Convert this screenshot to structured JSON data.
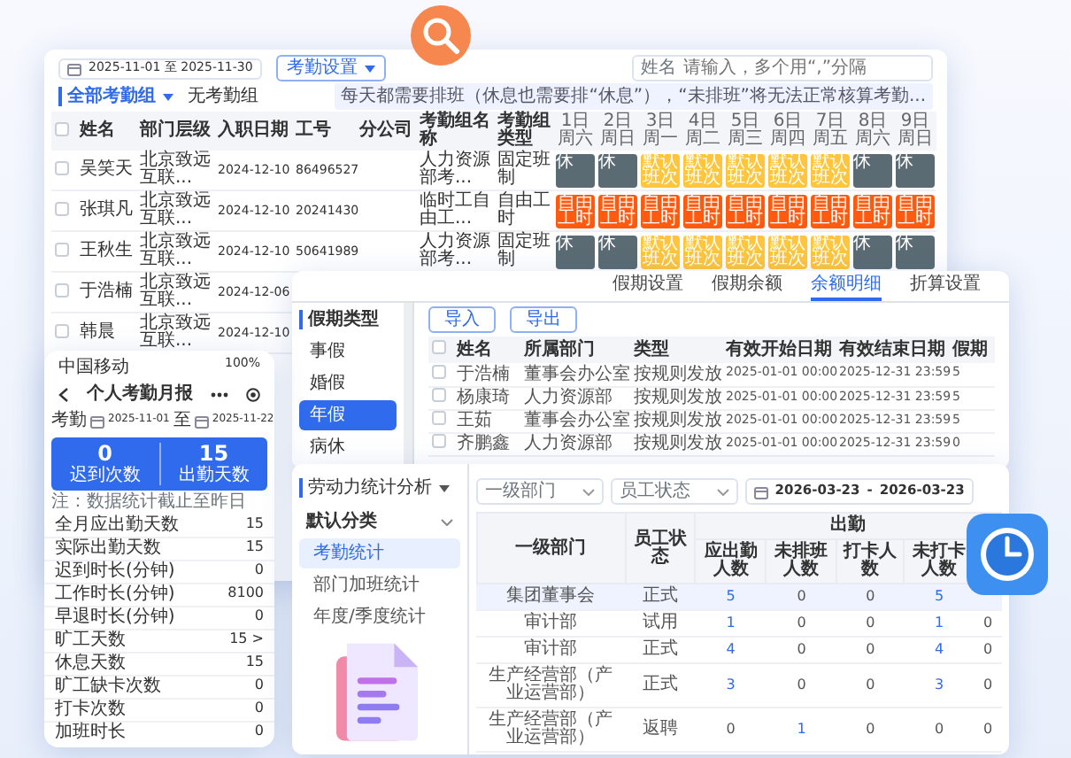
{
  "attendance_window": {
    "date_range": "2025-11-01 至 2025-11-30",
    "settings_button": "考勤设置",
    "search": {
      "label": "姓名",
      "placeholder": "请输入，多个用“,”分隔"
    },
    "group_filter": "全部考勤组",
    "no_group": "无考勤组",
    "notice": "每天都需要排班（休息也需要排“休息”），“未排班”将无法正常核算考勤...",
    "columns": [
      "姓名",
      "部门层级",
      "入职日期",
      "工号",
      "分公司",
      "考勤组名称",
      "考勤组类型"
    ],
    "days": [
      {
        "day": "1日",
        "weekday": "周六"
      },
      {
        "day": "2日",
        "weekday": "周日"
      },
      {
        "day": "3日",
        "weekday": "周一"
      },
      {
        "day": "4日",
        "weekday": "周二"
      },
      {
        "day": "5日",
        "weekday": "周三"
      },
      {
        "day": "6日",
        "weekday": "周四"
      },
      {
        "day": "7日",
        "weekday": "周五"
      },
      {
        "day": "8日",
        "weekday": "周六"
      },
      {
        "day": "9日",
        "weekday": "周日"
      }
    ],
    "select_all_checked": false,
    "rows": [
      {
        "checked": false,
        "name": "吴笑天",
        "dept": "北京致远互联...",
        "hire_date": "2024-12-10",
        "employee_no": "86496527",
        "group": "人力资源部考...",
        "group_type": "固定班制",
        "shifts": [
          {
            "kind": "rest",
            "label": "休"
          },
          {
            "kind": "rest",
            "label": "休"
          },
          {
            "kind": "default",
            "label": "默认班次"
          },
          {
            "kind": "default",
            "label": "默认班次"
          },
          {
            "kind": "default",
            "label": "默认班次"
          },
          {
            "kind": "default",
            "label": "默认班次"
          },
          {
            "kind": "default",
            "label": "默认班次"
          },
          {
            "kind": "rest",
            "label": "休"
          },
          {
            "kind": "rest",
            "label": "休"
          }
        ]
      },
      {
        "checked": false,
        "name": "张琪凡",
        "dept": "北京致远互联...",
        "hire_date": "2024-12-10",
        "employee_no": "20241430",
        "group": "临时工自由工...",
        "group_type": "自由工时",
        "shifts": [
          {
            "kind": "free",
            "label": "自由工时"
          },
          {
            "kind": "free",
            "label": "自由工时"
          },
          {
            "kind": "free",
            "label": "自由工时"
          },
          {
            "kind": "free",
            "label": "自由工时"
          },
          {
            "kind": "free",
            "label": "自由工时"
          },
          {
            "kind": "free",
            "label": "自由工时"
          },
          {
            "kind": "free",
            "label": "自由工时"
          },
          {
            "kind": "free",
            "label": "自由工时"
          },
          {
            "kind": "free",
            "label": "自由工时"
          }
        ]
      },
      {
        "checked": false,
        "name": "王秋生",
        "dept": "北京致远互联...",
        "hire_date": "2024-12-10",
        "employee_no": "50641989",
        "group": "人力资源部考...",
        "group_type": "固定班制",
        "shifts": [
          {
            "kind": "rest",
            "label": "休"
          },
          {
            "kind": "rest",
            "label": "休"
          },
          {
            "kind": "default",
            "label": "默认班次"
          },
          {
            "kind": "default",
            "label": "默认班次"
          },
          {
            "kind": "default",
            "label": "默认班次"
          },
          {
            "kind": "default",
            "label": "默认班次"
          },
          {
            "kind": "default",
            "label": "默认班次"
          },
          {
            "kind": "rest",
            "label": "休"
          },
          {
            "kind": "rest",
            "label": "休"
          }
        ]
      },
      {
        "checked": false,
        "name": "于浩楠",
        "dept": "北京致远互联...",
        "hire_date": "2024-12-06"
      },
      {
        "checked": false,
        "name": "韩晨",
        "dept": "北京致远互联...",
        "hire_date": "2024-12-10"
      }
    ]
  },
  "leave_window": {
    "tabs": [
      {
        "label": "假期设置",
        "selected": false
      },
      {
        "label": "假期余额",
        "selected": false
      },
      {
        "label": "余额明细",
        "selected": true
      },
      {
        "label": "折算设置",
        "selected": false
      }
    ],
    "sidebar_title": "假期类型",
    "leave_types": [
      {
        "label": "事假",
        "selected": false
      },
      {
        "label": "婚假",
        "selected": false
      },
      {
        "label": "年假",
        "selected": true
      },
      {
        "label": "病休",
        "selected": false
      }
    ],
    "buttons": [
      "导入",
      "导出"
    ],
    "select_all_checked": false,
    "columns": [
      "姓名",
      "所属部门",
      "类型",
      "有效开始日期",
      "有效结束日期",
      "假期"
    ],
    "rows": [
      {
        "checked": false,
        "cells": [
          "于浩楠",
          "董事会办公室",
          "按规则发放",
          "2025-01-01 00:00",
          "2025-12-31 23:59",
          "5"
        ]
      },
      {
        "checked": false,
        "cells": [
          "杨康琦",
          "人力资源部",
          "按规则发放",
          "2025-01-01 00:00",
          "2025-12-31 23:59",
          "5"
        ]
      },
      {
        "checked": false,
        "cells": [
          "王茹",
          "董事会办公室",
          "按规则发放",
          "2025-01-01 00:00",
          "2025-12-31 23:59",
          "5"
        ]
      },
      {
        "checked": false,
        "cells": [
          "齐鹏鑫",
          "人力资源部",
          "按规则发放",
          "2025-01-01 00:00",
          "2025-12-31 23:59",
          "0"
        ]
      }
    ]
  },
  "mobile": {
    "carrier": "中国移动",
    "battery": "100%",
    "title": "个人考勤月报",
    "date_label": "考勤",
    "date_from": "2025-11-01",
    "date_sep": "至",
    "date_to": "2025-11-22",
    "summary": [
      {
        "value": "0",
        "label": "迟到次数"
      },
      {
        "value": "15",
        "label": "出勤天数"
      }
    ],
    "note": "注：数据统计截止至昨日",
    "stats": [
      {
        "label": "全月应出勤天数",
        "value": "15"
      },
      {
        "label": "实际出勤天数",
        "value": "15"
      },
      {
        "label": "迟到时长(分钟)",
        "value": "0"
      },
      {
        "label": "工作时长(分钟)",
        "value": "8100"
      },
      {
        "label": "早退时长(分钟)",
        "value": "0"
      },
      {
        "label": "旷工天数",
        "value": "15 >"
      },
      {
        "label": "休息天数",
        "value": "15"
      },
      {
        "label": "旷工缺卡次数",
        "value": "0"
      },
      {
        "label": "打卡次数",
        "value": "0"
      },
      {
        "label": "加班时长",
        "value": "0"
      }
    ]
  },
  "stats_window": {
    "module": "劳动力统计分析",
    "category": "默认分类",
    "menu": [
      {
        "label": "考勤统计",
        "selected": true
      },
      {
        "label": "部门加班统计",
        "selected": false
      },
      {
        "label": "年度/季度统计",
        "selected": false
      }
    ],
    "filters": [
      {
        "placeholder": "一级部门"
      },
      {
        "placeholder": "员工状态"
      }
    ],
    "date_from": "2026-03-23",
    "date_sep": "-",
    "date_to": "2026-03-23",
    "columns": [
      "一级部门",
      "员工状态"
    ],
    "group_header": "出勤",
    "sub_columns": [
      "应出勤人数",
      "未排班人数",
      "打卡人数",
      "未打卡人数"
    ],
    "rows": [
      {
        "selected": true,
        "dept": "集团董事会",
        "status": "正式",
        "counts": [
          {
            "v": "5",
            "link": true
          },
          {
            "v": "0",
            "link": false
          },
          {
            "v": "0",
            "link": false
          },
          {
            "v": "5",
            "link": true
          }
        ]
      },
      {
        "selected": false,
        "dept": "审计部",
        "status": "试用",
        "counts": [
          {
            "v": "1",
            "link": true
          },
          {
            "v": "0",
            "link": false
          },
          {
            "v": "0",
            "link": false
          },
          {
            "v": "1",
            "link": true
          },
          {
            "v": "0",
            "link": false
          }
        ]
      },
      {
        "selected": false,
        "dept": "审计部",
        "status": "正式",
        "counts": [
          {
            "v": "4",
            "link": true
          },
          {
            "v": "0",
            "link": false
          },
          {
            "v": "0",
            "link": false
          },
          {
            "v": "4",
            "link": true
          },
          {
            "v": "0",
            "link": false
          }
        ]
      },
      {
        "selected": false,
        "dept": "生产经营部（产业运营部）",
        "status": "正式",
        "counts": [
          {
            "v": "3",
            "link": true
          },
          {
            "v": "0",
            "link": false
          },
          {
            "v": "0",
            "link": false
          },
          {
            "v": "3",
            "link": true
          },
          {
            "v": "0",
            "link": false
          }
        ]
      },
      {
        "selected": false,
        "dept": "生产经营部（产业运营部）",
        "status": "返聘",
        "counts": [
          {
            "v": "0",
            "link": false
          },
          {
            "v": "1",
            "link": true
          },
          {
            "v": "0",
            "link": false
          },
          {
            "v": "0",
            "link": false
          },
          {
            "v": "0",
            "link": false
          }
        ]
      }
    ]
  }
}
